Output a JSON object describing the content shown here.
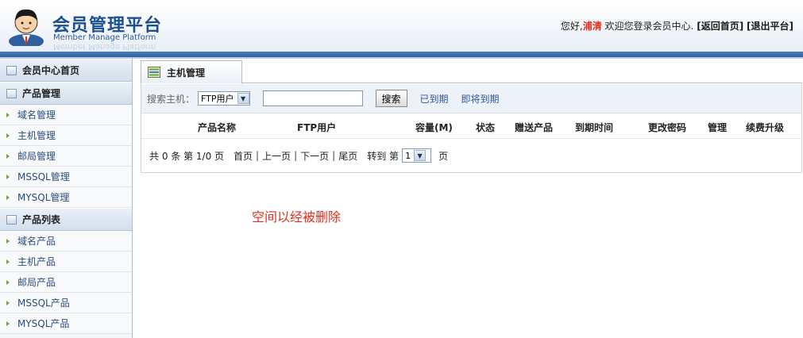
{
  "header": {
    "title": "会员管理平台",
    "subtitle": "Member Manage Platform",
    "greeting_prefix": "您好,",
    "username": "浦清",
    "greeting_suffix": " 欢迎您登录会员中心.",
    "home_link": "[返回首页]",
    "logout_link": "[退出平台]"
  },
  "sidebar": {
    "home": "会员中心首页",
    "groups": [
      {
        "title": "产品管理",
        "items": [
          "域名管理",
          "主机管理",
          "邮局管理",
          "MSSQL管理",
          "MYSQL管理"
        ]
      },
      {
        "title": "产品列表",
        "items": [
          "域名产品",
          "主机产品",
          "邮局产品",
          "MSSQL产品",
          "MYSQL产品"
        ]
      }
    ]
  },
  "main": {
    "tab_label": "主机管理",
    "search": {
      "label": "搜索主机：",
      "type_value": "FTP用户",
      "keyword_value": "",
      "button": "搜索",
      "expired": "已到期",
      "expiring": "即将到期"
    },
    "columns": [
      "产品名称",
      "FTP用户",
      "容量(M)",
      "状态",
      "赠送产品",
      "到期时间",
      "更改密码",
      "管理",
      "续费升级"
    ],
    "pager": {
      "total": "共 0 条 第 1/0 页",
      "first": "首页",
      "prev": "上一页",
      "next": "下一页",
      "last": "尾页",
      "goto": "转到 第",
      "page_value": "1",
      "page_unit": "页"
    },
    "notice": "空间以经被删除"
  },
  "colors": {
    "accent": "#2f5f9f",
    "alert": "#e0301e"
  }
}
